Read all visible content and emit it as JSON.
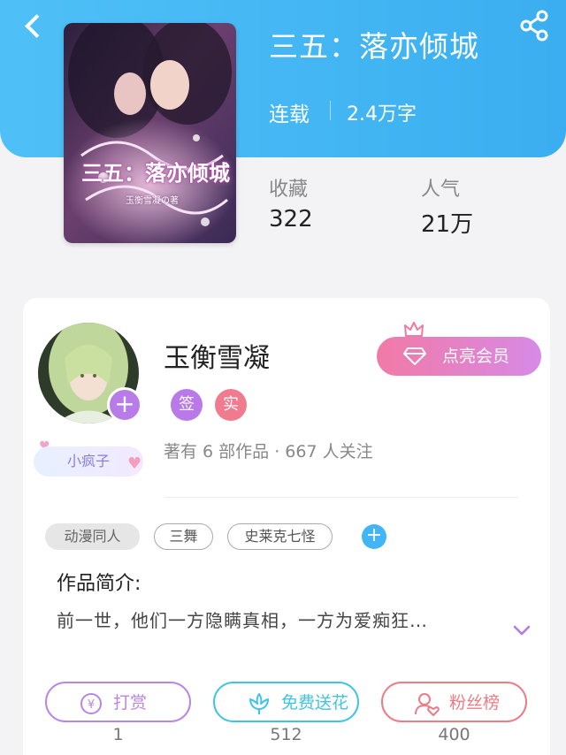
{
  "header": {
    "back_icon": "chevron-left-icon",
    "share_icon": "share-icon"
  },
  "book": {
    "title": "三五：落亦倾城",
    "status": "连载",
    "word_count": "2.4万字",
    "cover_text": "三五：落亦倾城",
    "cover_subtext": "玉衡雪凝の著"
  },
  "stats": [
    {
      "label": "收藏",
      "value": "322"
    },
    {
      "label": "人气",
      "value": "21万"
    }
  ],
  "author": {
    "name": "玉衡雪凝",
    "badges": [
      {
        "label": "签",
        "color": "#b979e8"
      },
      {
        "label": "实",
        "color": "#f07a8e"
      }
    ],
    "meta": "著有 6 部作品 · 667 人关注",
    "nickname_badge": "小疯子",
    "follow_icon": "plus-icon"
  },
  "vip": {
    "label": "点亮会员",
    "icon": "diamond-icon",
    "crown_icon": "crown-icon"
  },
  "tags": [
    "动漫同人",
    "三舞",
    "史莱克七怪"
  ],
  "intro": {
    "title": "作品简介:",
    "text": "前一世，他们一方隐瞒真相，一方为爱痴狂…"
  },
  "actions": [
    {
      "label": "打赏",
      "count": "1",
      "icon": "yen-icon",
      "color": "#b886e6"
    },
    {
      "label": "免费送花",
      "count": "512",
      "icon": "flower-icon",
      "color": "#40c4e4"
    },
    {
      "label": "粉丝榜",
      "count": "400",
      "icon": "fan-icon",
      "color": "#ee7b86"
    }
  ]
}
